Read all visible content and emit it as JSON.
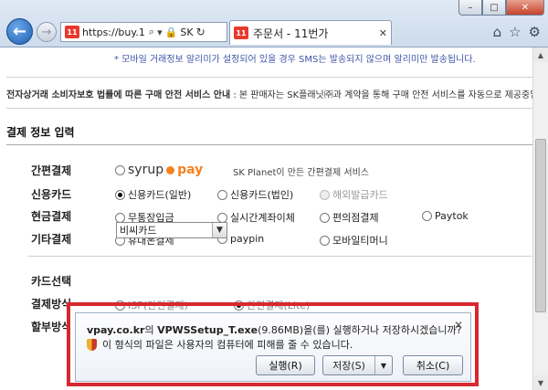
{
  "browser": {
    "url": "https://buy.1...",
    "site_badge": "SK",
    "tab_title": "주문서 - 11번가",
    "favicon_text": "11"
  },
  "content": {
    "sms_note": "* 모바일 거래정보 알리미가 설정되어 있을 경우 SMS는 발송되지 않으며 알리미만 발송됩니다.",
    "safety_bold": "전자상거래 소비자보호 법률에 따른 구매 안전 서비스 안내",
    "safety_text": " : 본 판매자는 SK플래닛㈜과 계약을 통해 구매 안전 서비스를 자동으로 제공중입니",
    "section_title": "결제 정보 입력",
    "rows": [
      {
        "label": "간편결제"
      },
      {
        "label": "신용카드"
      },
      {
        "label": "현금결제"
      },
      {
        "label": "기타결제"
      }
    ],
    "syrup": {
      "a": "syrup",
      "b": "pay",
      "desc": "SK Planet이 만든 간편결제 서비스"
    },
    "credit": [
      "신용카드(일반)",
      "신용카드(법인)",
      "해외발급카드"
    ],
    "cash": [
      "무통장입금",
      "실시간계좌이체",
      "편의점결제",
      "Paytok"
    ],
    "other": [
      "휴대폰결제",
      "paypin",
      "모바일티머니"
    ],
    "card_label": "카드선택",
    "card_value": "비씨카드",
    "method_label": "결제방식",
    "method_opt1": "ISP(안전결제)",
    "method_opt2": "간편결제(Lite)",
    "installment_label": "할부방식"
  },
  "download": {
    "site": "vpay.co.kr",
    "mid1": "의 ",
    "file": "VPWSSetup_T.exe",
    "size": "(9.86MB)을(를) 실행하거나 저장하시겠습니까?",
    "warning": "이 형식의 파일은 사용자의 컴퓨터에 피해를 줄 수 있습니다.",
    "run": "실행(R)",
    "save": "저장(S)",
    "cancel": "취소(C)"
  }
}
